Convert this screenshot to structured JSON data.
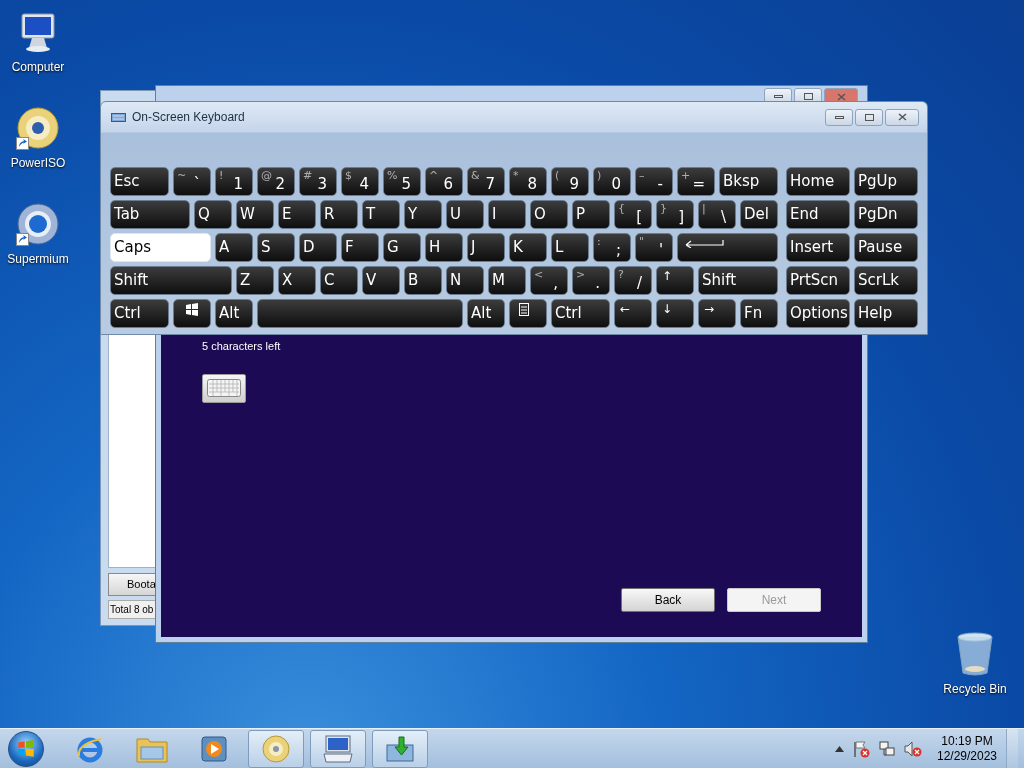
{
  "desktop_icons": [
    {
      "kind": "computer",
      "label": "Computer",
      "shortcut": false
    },
    {
      "kind": "disc",
      "label": "PowerISO",
      "shortcut": true
    },
    {
      "kind": "browser",
      "label": "Supermium",
      "shortcut": true
    },
    {
      "kind": "recycle",
      "label": "Recycle Bin",
      "shortcut": false
    }
  ],
  "background_window": {
    "button": "Boota",
    "status": "Total 8 ob"
  },
  "setup_window": {
    "hint": "5 characters left",
    "buttons": [
      {
        "label": "Back",
        "disabled": false
      },
      {
        "label": "Next",
        "disabled": true
      }
    ]
  },
  "osk": {
    "title": "On-Screen Keyboard",
    "main_rows": [
      [
        {
          "kind": "text",
          "label": "Esc",
          "pressed": false
        },
        {
          "kind": "text",
          "label": "`",
          "shift": "~",
          "pressed": false
        },
        {
          "kind": "text",
          "label": "1",
          "shift": "!",
          "pressed": false
        },
        {
          "kind": "text",
          "label": "2",
          "shift": "@",
          "pressed": false
        },
        {
          "kind": "text",
          "label": "3",
          "shift": "#",
          "pressed": false
        },
        {
          "kind": "text",
          "label": "4",
          "shift": "$",
          "pressed": false
        },
        {
          "kind": "text",
          "label": "5",
          "shift": "%",
          "pressed": false
        },
        {
          "kind": "text",
          "label": "6",
          "shift": "^",
          "pressed": false
        },
        {
          "kind": "text",
          "label": "7",
          "shift": "&",
          "pressed": false
        },
        {
          "kind": "text",
          "label": "8",
          "shift": "*",
          "pressed": false
        },
        {
          "kind": "text",
          "label": "9",
          "shift": "(",
          "pressed": false
        },
        {
          "kind": "text",
          "label": "0",
          "shift": ")",
          "pressed": false
        },
        {
          "kind": "text",
          "label": "-",
          "shift": "–",
          "pressed": false
        },
        {
          "kind": "text",
          "label": "=",
          "shift": "+",
          "pressed": false
        },
        {
          "kind": "text",
          "label": "Bksp",
          "pressed": false
        }
      ],
      [
        {
          "kind": "text",
          "label": "Tab",
          "pressed": false
        },
        {
          "kind": "text",
          "label": "Q",
          "pressed": false
        },
        {
          "kind": "text",
          "label": "W",
          "pressed": false
        },
        {
          "kind": "text",
          "label": "E",
          "pressed": false
        },
        {
          "kind": "text",
          "label": "R",
          "pressed": false
        },
        {
          "kind": "text",
          "label": "T",
          "pressed": false
        },
        {
          "kind": "text",
          "label": "Y",
          "pressed": false
        },
        {
          "kind": "text",
          "label": "U",
          "pressed": false
        },
        {
          "kind": "text",
          "label": "I",
          "pressed": false
        },
        {
          "kind": "text",
          "label": "O",
          "pressed": false
        },
        {
          "kind": "text",
          "label": "P",
          "pressed": false
        },
        {
          "kind": "text",
          "label": "[",
          "shift": "{",
          "pressed": false
        },
        {
          "kind": "text",
          "label": "]",
          "shift": "}",
          "pressed": false
        },
        {
          "kind": "text",
          "label": "\\",
          "shift": "|",
          "pressed": false
        },
        {
          "kind": "text",
          "label": "Del",
          "pressed": false
        }
      ],
      [
        {
          "kind": "text",
          "label": "Caps",
          "pressed": true
        },
        {
          "kind": "text",
          "label": "A",
          "pressed": false
        },
        {
          "kind": "text",
          "label": "S",
          "pressed": false
        },
        {
          "kind": "text",
          "label": "D",
          "pressed": false
        },
        {
          "kind": "text",
          "label": "F",
          "pressed": false
        },
        {
          "kind": "text",
          "label": "G",
          "pressed": false
        },
        {
          "kind": "text",
          "label": "H",
          "pressed": false
        },
        {
          "kind": "text",
          "label": "J",
          "pressed": false
        },
        {
          "kind": "text",
          "label": "K",
          "pressed": false
        },
        {
          "kind": "text",
          "label": "L",
          "pressed": false
        },
        {
          "kind": "text",
          "label": ";",
          "shift": ":",
          "pressed": false
        },
        {
          "kind": "text",
          "label": "'",
          "shift": "\"",
          "pressed": false
        },
        {
          "kind": "enter",
          "pressed": false
        }
      ],
      [
        {
          "kind": "text",
          "label": "Shift",
          "pressed": false
        },
        {
          "kind": "text",
          "label": "Z",
          "pressed": false
        },
        {
          "kind": "text",
          "label": "X",
          "pressed": false
        },
        {
          "kind": "text",
          "label": "C",
          "pressed": false
        },
        {
          "kind": "text",
          "label": "V",
          "pressed": false
        },
        {
          "kind": "text",
          "label": "B",
          "pressed": false
        },
        {
          "kind": "text",
          "label": "N",
          "pressed": false
        },
        {
          "kind": "text",
          "label": "M",
          "pressed": false
        },
        {
          "kind": "text",
          "label": ",",
          "shift": "<",
          "pressed": false
        },
        {
          "kind": "text",
          "label": ".",
          "shift": ">",
          "pressed": false
        },
        {
          "kind": "text",
          "label": "/",
          "shift": "?",
          "pressed": false
        },
        {
          "kind": "arrow",
          "label": "↑",
          "pressed": false
        },
        {
          "kind": "text",
          "label": "Shift",
          "pressed": false
        }
      ],
      [
        {
          "kind": "text",
          "label": "Ctrl",
          "pressed": false
        },
        {
          "kind": "windows",
          "pressed": false
        },
        {
          "kind": "text",
          "label": "Alt",
          "pressed": false
        },
        {
          "kind": "space",
          "pressed": false
        },
        {
          "kind": "text",
          "label": "Alt",
          "pressed": false
        },
        {
          "kind": "menu",
          "pressed": false
        },
        {
          "kind": "text",
          "label": "Ctrl",
          "pressed": false
        },
        {
          "kind": "arrow",
          "label": "←",
          "pressed": false
        },
        {
          "kind": "arrow",
          "label": "↓",
          "pressed": false
        },
        {
          "kind": "arrow",
          "label": "→",
          "pressed": false
        },
        {
          "kind": "text",
          "label": "Fn",
          "pressed": false
        }
      ]
    ],
    "side_rows": [
      [
        {
          "kind": "text",
          "label": "Home",
          "pressed": false
        },
        {
          "kind": "text",
          "label": "PgUp",
          "pressed": false
        }
      ],
      [
        {
          "kind": "text",
          "label": "End",
          "pressed": false
        },
        {
          "kind": "text",
          "label": "PgDn",
          "pressed": false
        }
      ],
      [
        {
          "kind": "text",
          "label": "Insert",
          "pressed": false
        },
        {
          "kind": "text",
          "label": "Pause",
          "pressed": false
        }
      ],
      [
        {
          "kind": "text",
          "label": "PrtScn",
          "pressed": false
        },
        {
          "kind": "text",
          "label": "ScrLk",
          "pressed": false
        }
      ],
      [
        {
          "kind": "text",
          "label": "Options",
          "pressed": false
        },
        {
          "kind": "text",
          "label": "Help",
          "pressed": false
        }
      ]
    ]
  },
  "taskbar": {
    "items": [
      {
        "kind": "ie",
        "running": false
      },
      {
        "kind": "folder",
        "running": false
      },
      {
        "kind": "media",
        "running": false
      },
      {
        "kind": "disc",
        "running": true
      },
      {
        "kind": "keyboard",
        "running": true
      },
      {
        "kind": "setup",
        "running": true
      }
    ],
    "clock": {
      "time": "10:19 PM",
      "date": "12/29/2023"
    }
  }
}
